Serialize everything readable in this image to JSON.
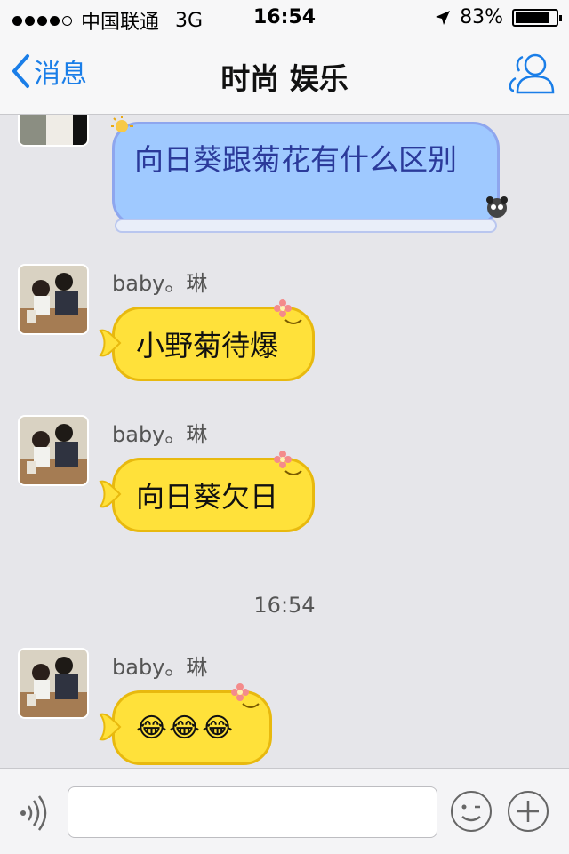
{
  "status": {
    "carrier": "中国联通",
    "network": "3G",
    "time": "16:54",
    "battery": "83%",
    "battery_level": 0.83
  },
  "nav": {
    "back_label": "消息",
    "title": "时尚 娱乐"
  },
  "messages": [
    {
      "type": "outgoing",
      "text": "向日葵跟菊花有什么区别"
    },
    {
      "type": "incoming",
      "sender": "baby。琳",
      "text": "小野菊待爆"
    },
    {
      "type": "incoming",
      "sender": "baby。琳",
      "text": "向日葵欠日"
    },
    {
      "type": "incoming",
      "sender": "baby。琳",
      "text": "😂😂😂"
    }
  ],
  "timestamp": "16:54",
  "icons": {
    "back": "chevron-left-icon",
    "people": "people-icon",
    "voice": "voice-icon",
    "smile": "emoji-icon",
    "plus": "plus-icon"
  },
  "colors": {
    "accent": "#1a7ee8",
    "outgoing_bubble": "#9fc9ff",
    "incoming_bubble": "#ffe13a"
  }
}
